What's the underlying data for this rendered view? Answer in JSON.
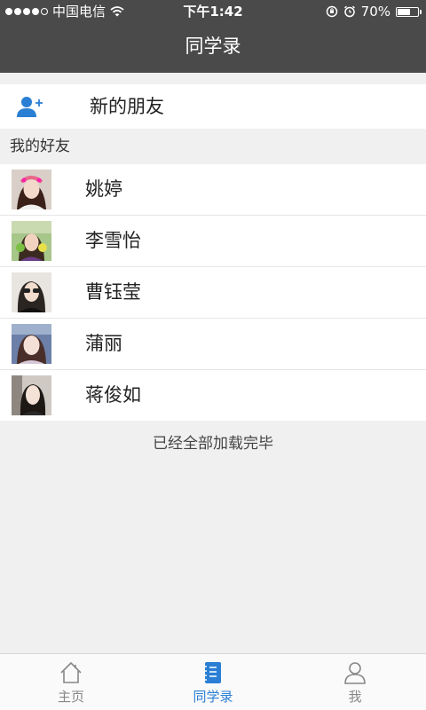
{
  "status_bar": {
    "carrier": "中国电信",
    "time": "下午1:42",
    "battery_percent": "70%",
    "battery_level": 0.7,
    "signal_bars": 4
  },
  "nav": {
    "title": "同学录"
  },
  "new_friends": {
    "label": "新的朋友",
    "icon": "add-user-icon"
  },
  "section": {
    "title": "我的好友"
  },
  "friends": [
    {
      "name": "姚婷"
    },
    {
      "name": "李雪怡"
    },
    {
      "name": "曹钰莹"
    },
    {
      "name": "蒲丽"
    },
    {
      "name": "蒋俊如"
    }
  ],
  "load_status": "已经全部加载完毕",
  "tabs": [
    {
      "label": "主页",
      "icon": "home-icon"
    },
    {
      "label": "同学录",
      "icon": "contacts-book-icon"
    },
    {
      "label": "我",
      "icon": "profile-icon"
    }
  ],
  "colors": {
    "header_bg": "#4a4a4a",
    "accent": "#2a7fd4",
    "page_bg": "#f0f0f0"
  }
}
